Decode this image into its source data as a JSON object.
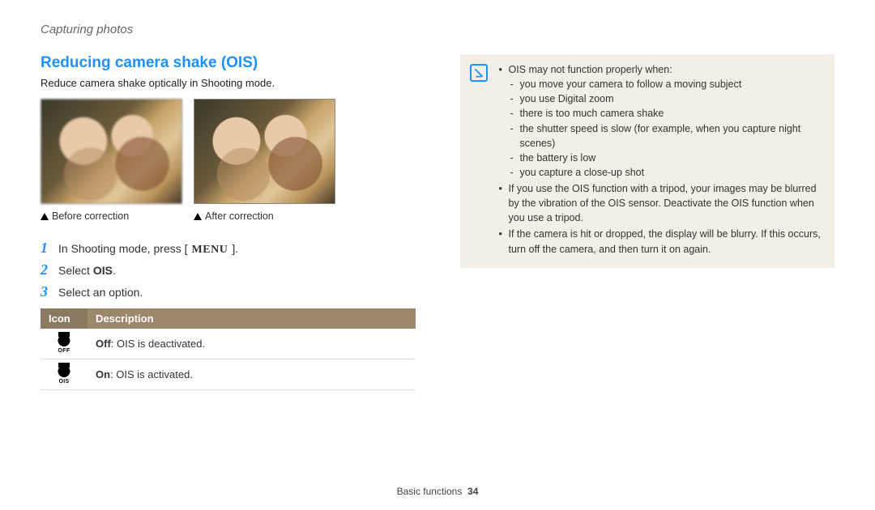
{
  "breadcrumb": "Capturing photos",
  "title": "Reducing camera shake (OIS)",
  "intro": "Reduce camera shake optically in Shooting mode.",
  "captions": {
    "before": "Before correction",
    "after": "After correction"
  },
  "steps": [
    {
      "num": "1",
      "pre": "In Shooting mode, press [",
      "icon": "MENU",
      "post": "]."
    },
    {
      "num": "2",
      "pre": "Select ",
      "bold": "OIS",
      "post": "."
    },
    {
      "num": "3",
      "pre": "Select an option."
    }
  ],
  "table": {
    "headers": {
      "icon": "Icon",
      "desc": "Description"
    },
    "rows": [
      {
        "sub": "OFF",
        "label": "Off",
        "desc": ": OIS is deactivated."
      },
      {
        "sub": "OIS",
        "label": "On",
        "desc": ": OIS is activated."
      }
    ]
  },
  "notes": {
    "lead": "OIS may not function properly when:",
    "items": [
      "you move your camera to follow a moving subject",
      "you use Digital zoom",
      "there is too much camera shake",
      "the shutter speed is slow (for example, when you capture night scenes)",
      "the battery is low",
      "you capture a close-up shot"
    ],
    "extra": [
      "If you use the OIS function with a tripod, your images may be blurred by the vibration of the OIS sensor. Deactivate the OIS function when you use a tripod.",
      "If the camera is hit or dropped, the display will be blurry. If this occurs, turn off the camera, and then turn it on again."
    ]
  },
  "footer": {
    "section": "Basic functions",
    "page": "34"
  }
}
